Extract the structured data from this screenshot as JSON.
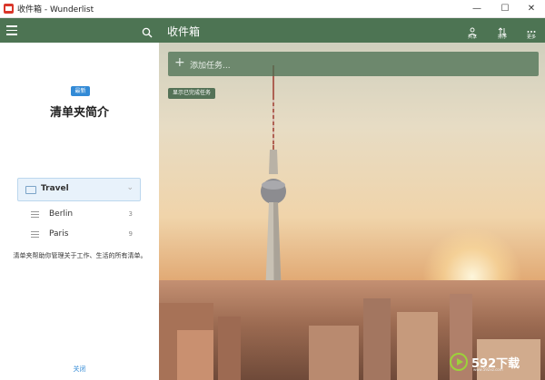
{
  "window": {
    "title": "收件箱 - Wunderlist",
    "minimize_glyph": "—",
    "maximize_glyph": "☐",
    "close_glyph": "✕"
  },
  "colors": {
    "header_green": "#4d7453",
    "badge_blue": "#328ad6",
    "folder_bg": "#e8f2fb"
  },
  "sidebar": {
    "new_badge": "最新",
    "intro_title": "清单夹简介",
    "folder": {
      "label": "Travel",
      "icon": "folder-icon",
      "chevron": "chevron-down-icon"
    },
    "lists": [
      {
        "label": "Berlin",
        "count": "3"
      },
      {
        "label": "Paris",
        "count": "9"
      }
    ],
    "description": "清单夹帮助你管理关于工作、生活的所有清单。",
    "close_label": "关闭"
  },
  "main": {
    "title": "收件箱",
    "actions": [
      {
        "label": "共享",
        "icon": "share-user-icon"
      },
      {
        "label": "排序",
        "icon": "sort-icon"
      },
      {
        "label": "更多",
        "icon": "more-dots-icon"
      }
    ],
    "add_task_placeholder": "添加任务...",
    "show_completed_label": "显示已完成任务"
  },
  "watermark": {
    "text": "592下载",
    "sub": "www.592xz.com"
  }
}
